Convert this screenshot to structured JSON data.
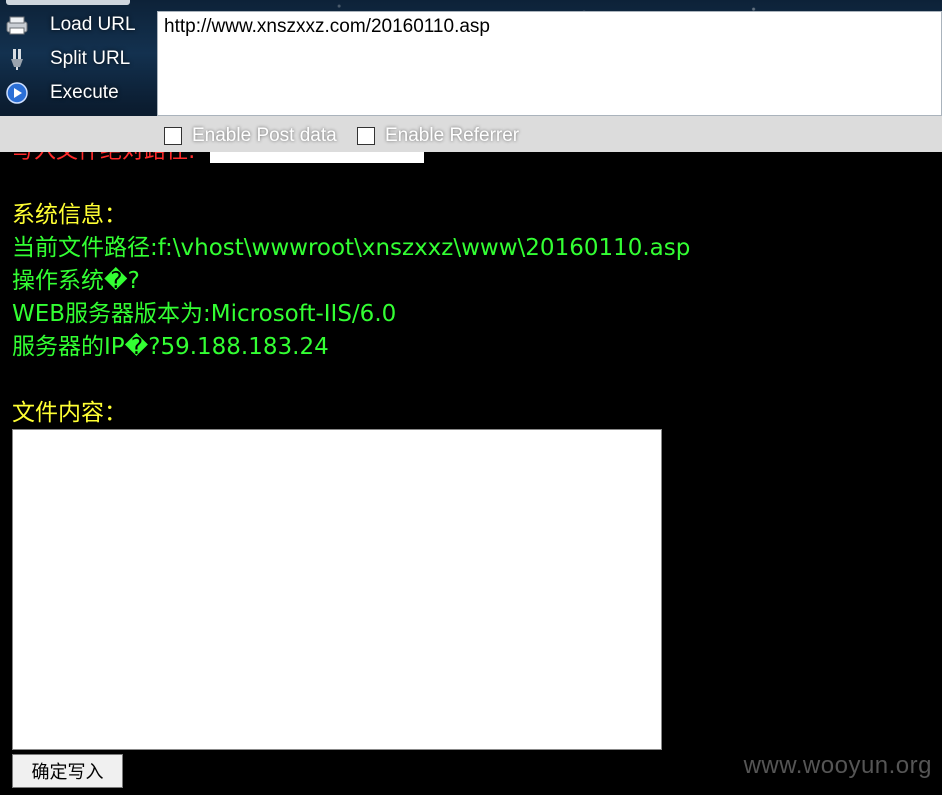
{
  "toolbar": {
    "menu": [
      {
        "label": "Load URL",
        "icon": "load-url-icon"
      },
      {
        "label": "Split URL",
        "icon": "split-url-icon"
      },
      {
        "label": "Execute",
        "icon": "execute-icon"
      }
    ],
    "url_value": "http://www.xnszxxz.com/20160110.asp",
    "options": [
      {
        "label": "Enable Post data",
        "checked": false
      },
      {
        "label": "Enable Referrer",
        "checked": false
      }
    ]
  },
  "page": {
    "cut_label": "写入文件绝对路径:",
    "system_info_heading": "系统信息：",
    "current_path": "当前文件路径:f:\\vhost\\wwwroot\\xnszxxz\\www\\20160110.asp",
    "os_line": "操作系统�?",
    "web_server": "WEB服务器版本为:Microsoft-IIS/6.0",
    "server_ip": "服务器的IP�?59.188.183.24",
    "file_content_heading": "文件内容：",
    "file_content_value": "",
    "submit_label": "确定写入"
  },
  "watermark": "www.wooyun.org",
  "colors": {
    "heading": "#ffff33",
    "info": "#33ff33",
    "cut_label": "#ff2a2a",
    "background": "#000000"
  }
}
